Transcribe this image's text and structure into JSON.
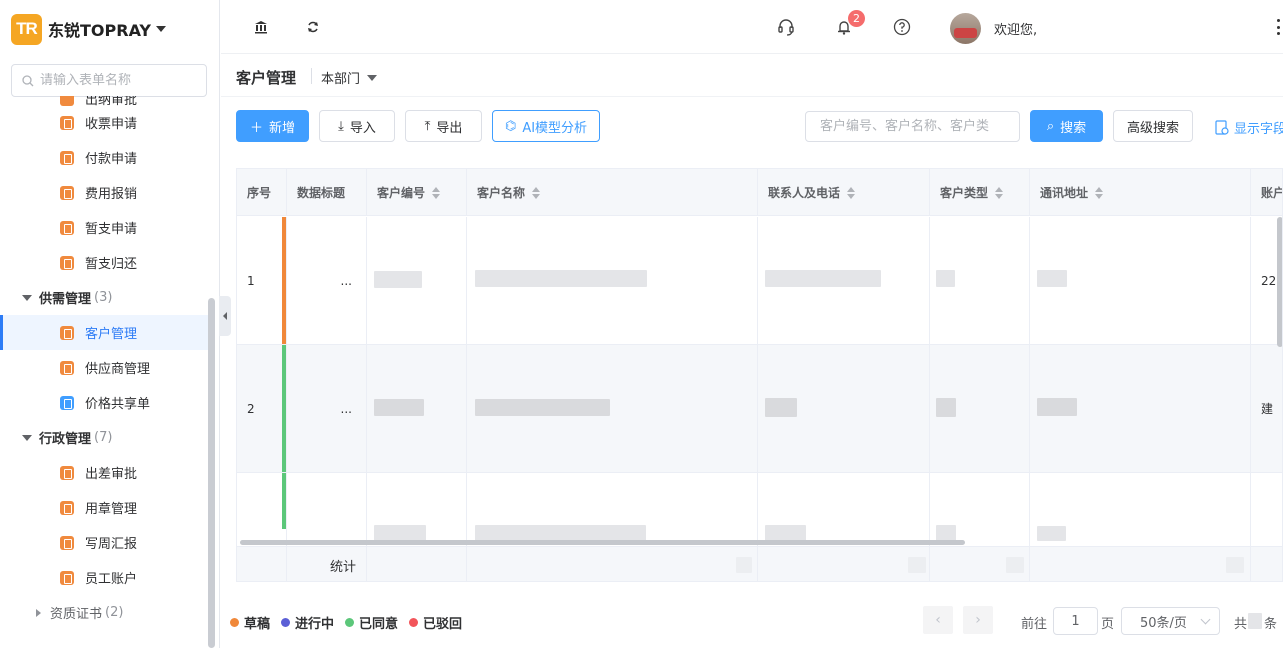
{
  "brand": {
    "logo_text": "TR",
    "name": "东锐TOPRAY"
  },
  "sidebar": {
    "search_placeholder": "请输入表单名称",
    "partial_item": "出纳审批",
    "items_before": [
      {
        "label": "收票申请"
      },
      {
        "label": "付款申请"
      },
      {
        "label": "费用报销"
      },
      {
        "label": "暂支申请"
      },
      {
        "label": "暂支归还"
      }
    ],
    "group1": {
      "label": "供需管理",
      "count": "(3)"
    },
    "group1_items": [
      {
        "label": "客户管理"
      },
      {
        "label": "供应商管理"
      },
      {
        "label": "价格共享单"
      }
    ],
    "group2": {
      "label": "行政管理",
      "count": "(7)"
    },
    "group2_items": [
      {
        "label": "出差审批"
      },
      {
        "label": "用章管理"
      },
      {
        "label": "写周汇报"
      },
      {
        "label": "员工账户"
      }
    ],
    "sub_group": {
      "label": "资质证书",
      "count": "(2)"
    }
  },
  "topbar": {
    "bell_count": "2",
    "welcome": "欢迎您,"
  },
  "page": {
    "title": "客户管理",
    "department": "本部门"
  },
  "toolbar": {
    "add": "新增",
    "import": "导入",
    "export": "导出",
    "ai": "AI模型分析",
    "search_placeholder": "客户编号、客户名称、客户类",
    "search": "搜索",
    "advanced": "高级搜索",
    "show_fields": "显示字段"
  },
  "table": {
    "headers": [
      "序号",
      "数据标题",
      "客户编号",
      "客户名称",
      "联系人及电话",
      "客户类型",
      "通讯地址",
      "账户"
    ],
    "rows": [
      {
        "index": "1",
        "title": "...",
        "last": "22"
      },
      {
        "index": "2",
        "title": "...",
        "last": "建"
      },
      {
        "index": "",
        "title": "",
        "last": ""
      }
    ],
    "summary_label": "统计"
  },
  "legend": [
    {
      "label": "草稿",
      "color": "#f0883a"
    },
    {
      "label": "进行中",
      "color": "#5b5fd6"
    },
    {
      "label": "已同意",
      "color": "#5cc77a"
    },
    {
      "label": "已驳回",
      "color": "#f2555a"
    }
  ],
  "pagination": {
    "goto": "前往",
    "page_value": "1",
    "page_unit": "页",
    "page_size": "50条/页",
    "total_prefix": "共",
    "total_suffix": "条"
  }
}
